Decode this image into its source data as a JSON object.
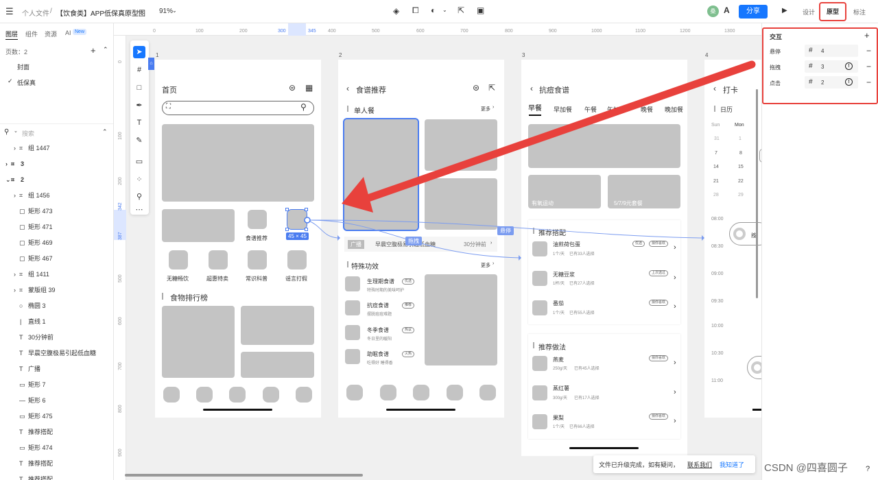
{
  "topbar": {
    "menu_icon": "menu-icon",
    "breadcrumb_root": "个人文件",
    "breadcrumb_sep": "/",
    "file_name": "【饮食类】APP低保真原型图",
    "zoom": "91%",
    "avatar_letter": "桑",
    "share": "分享",
    "mode_design": "设计",
    "mode_prototype": "原型",
    "mode_annotate": "标注"
  },
  "leftpanel": {
    "tabs": [
      "图层",
      "组件",
      "资源",
      "AI"
    ],
    "ai_badge": "New",
    "pages_label": "页数：2",
    "pages": [
      "封面",
      "低保真"
    ],
    "search_placeholder": "搜索",
    "layers": [
      "组 1447",
      "3",
      "2",
      "组 1456",
      "矩形 473",
      "矩形 471",
      "矩形 469",
      "矩形 467",
      "组 1411",
      "蒙版组 39",
      "椭圆 3",
      "直线 1",
      "30分钟前",
      "早晨空腹极易引起低血糖",
      "广播",
      "矩形 7",
      "矩形 6",
      "矩形 475",
      "推荐搭配",
      "矩形 474",
      "推荐搭配",
      "推荐搭配"
    ]
  },
  "ruler": {
    "top": [
      "0",
      "100",
      "200",
      "300",
      "345",
      "400",
      "500",
      "600",
      "700",
      "800",
      "900",
      "1000",
      "1100",
      "1200",
      "1300"
    ],
    "left": [
      "0",
      "100",
      "200",
      "342",
      "387",
      "500",
      "600",
      "700",
      "800",
      "900"
    ]
  },
  "frames": {
    "labels": [
      "1",
      "2",
      "3",
      "4"
    ],
    "home": {
      "title": "首页",
      "icons": [
        "食谱推荐",
        "无糖畅饮",
        "超惠特卖",
        "常识科普",
        "谣言打假"
      ],
      "ranking_title": "食物排行榜",
      "size_badge": "45 × 45"
    },
    "recipe": {
      "title": "食谱推荐",
      "section1": "单人餐",
      "more": "更多",
      "broadcast_tag": "广播",
      "broadcast_text": "早晨空腹极易引起低血糖",
      "broadcast_time": "30分钟前",
      "section2": "特殊功效",
      "items": [
        {
          "name": "生理期食谱",
          "desc": "特殊时期的美味呵护",
          "tag": "优选"
        },
        {
          "name": "抗痘食谱",
          "desc": "摆脱痘痘难题",
          "tag": "推荐"
        },
        {
          "name": "冬季食谱",
          "desc": "冬日里的暖阳",
          "tag": "热议"
        },
        {
          "name": "助眠食谱",
          "desc": "吃得好 睡得香",
          "tag": "火热"
        }
      ]
    },
    "acne": {
      "title": "抗痘食谱",
      "tabs": [
        "早餐",
        "早加餐",
        "午餐",
        "午加餐",
        "晚餐",
        "晚加餐"
      ],
      "promo1": "有氧运动",
      "promo2": "5/7/9元套餐",
      "section1": "推荐搭配",
      "combos": [
        {
          "name": "油煎荷包蛋",
          "qty": "1个/天",
          "count": "已有33人选择",
          "tag": "优选",
          "tag2": "猜你喜欢"
        },
        {
          "name": "无糖豆浆",
          "qty": "1杯/天",
          "count": "已有27人选择",
          "tag": "上次选过"
        },
        {
          "name": "番茄",
          "qty": "1个/天",
          "count": "已有55人选择",
          "tag": "猜你喜欢"
        }
      ],
      "section2": "推荐做法",
      "methods": [
        {
          "name": "燕麦",
          "qty": "250g/天",
          "count": "已有45人选择",
          "tag": "猜你喜欢"
        },
        {
          "name": "蒸红薯",
          "qty": "300g/天",
          "count": "已有17人选择",
          "tag": ""
        },
        {
          "name": "果梨",
          "qty": "1个/天",
          "count": "已有66人选择",
          "tag": "猜你喜欢"
        }
      ]
    },
    "checkin": {
      "title": "打卡",
      "calendar": "日历",
      "weekdays": [
        "Sun",
        "Mon"
      ],
      "days_sun": [
        "31",
        "7",
        "14",
        "21",
        "28"
      ],
      "days_mon": [
        "1",
        "8",
        "15",
        "22",
        "29"
      ],
      "times": [
        "08:00",
        "08:30",
        "09:00",
        "09:30",
        "10:00",
        "10:30",
        "11:00"
      ],
      "cut_text": "按"
    }
  },
  "connectors": {
    "drag": "拖拽",
    "hover": "悬停"
  },
  "rightpanel": {
    "title": "交互",
    "rows": [
      {
        "label": "悬停",
        "target": "4"
      },
      {
        "label": "拖拽",
        "target": "3"
      },
      {
        "label": "点击",
        "target": "2"
      }
    ]
  },
  "toast": {
    "text": "文件已升级完成，如有疑问，",
    "link": "联系我们",
    "ok": "我知道了"
  },
  "watermark": "CSDN @四喜圆子",
  "help": "?",
  "colors": {
    "accent": "#1677ff",
    "selection": "#7b9cf0",
    "annotation_red": "#e8413c",
    "placeholder_gray": "#c4c4c4"
  }
}
